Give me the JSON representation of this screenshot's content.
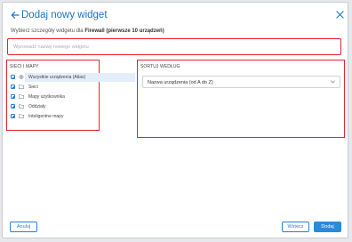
{
  "dialog": {
    "title": "Dodaj nowy widget",
    "subtitle_prefix": "Wybierz szczegóły widgetu dla",
    "subtitle_bold": "Firewall (pierwsze 10 urządzeń)"
  },
  "name_input": {
    "placeholder": "Wprowadź nazwę nowego widgetu",
    "value": ""
  },
  "tree": {
    "label": "SIECI I MAPY",
    "items": [
      {
        "label": "Wszystkie urządzenia (Atlas)",
        "icon": "globe-icon",
        "selected": true
      },
      {
        "label": "Sieci",
        "icon": "folder-icon",
        "toggle": "plus"
      },
      {
        "label": "Mapy użytkownika",
        "icon": "folder-icon",
        "toggle": "plus"
      },
      {
        "label": "Oddziały",
        "icon": "folder-icon",
        "toggle": "plus"
      },
      {
        "label": "Inteligentne mapy",
        "icon": "folder-icon",
        "toggle": "plus"
      }
    ]
  },
  "sort": {
    "label": "SORTUJ WEDŁUG",
    "selected": "Nazwa urządzenia (od A do Z)"
  },
  "footer": {
    "cancel_label": "Anuluj",
    "back_label": "Wstecz",
    "add_label": "Dodaj"
  },
  "colors": {
    "accent": "#2a7fd4",
    "primary_button": "#2a8bd9",
    "highlight_border": "#e0252e",
    "selected_row": "#e4eefb"
  }
}
